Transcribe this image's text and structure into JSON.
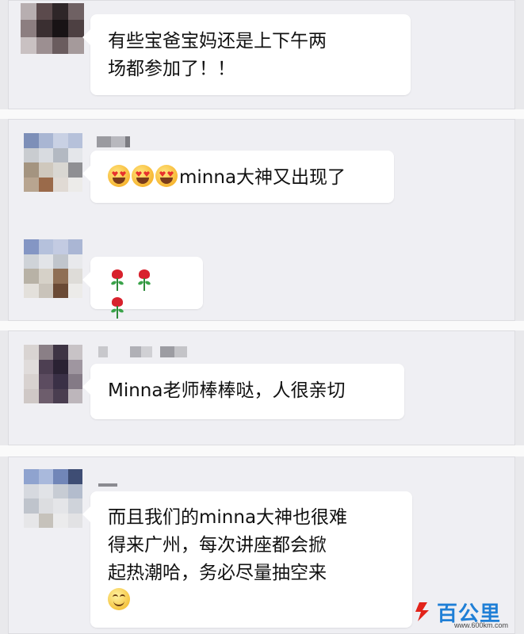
{
  "messages": [
    {
      "text": "有些宝爸宝妈还是上下午两\n场都参加了！！",
      "emoji_prefix": [],
      "emoji_suffix": [],
      "sender_name_hidden": true
    },
    {
      "text": "minna大神又出现了",
      "emoji_prefix": [
        "heart-eyes-emoji",
        "heart-eyes-emoji",
        "heart-eyes-emoji"
      ],
      "sender_name_hidden": true
    },
    {
      "text": "",
      "emoji_prefix": [
        "rose-emoji",
        "rose-emoji",
        "rose-emoji"
      ]
    },
    {
      "text": "Minna老师棒棒哒，人很亲切",
      "sender_name_hidden": true
    },
    {
      "text": "而且我们的minna大神也很难\n得来广州，每次讲座都会掀\n起热潮哈，务必尽量抽空来",
      "emoji_suffix": [
        "smile-emoji"
      ],
      "sender_name_hidden": true
    }
  ],
  "watermark": {
    "brand": "百公里",
    "url": "www.600km.com",
    "accent_color": "#1f7fd6",
    "logo_color": "#e2231a"
  },
  "colors": {
    "card_background": "#efeff3",
    "bubble_background": "#ffffff",
    "separator": "#fafafa"
  }
}
